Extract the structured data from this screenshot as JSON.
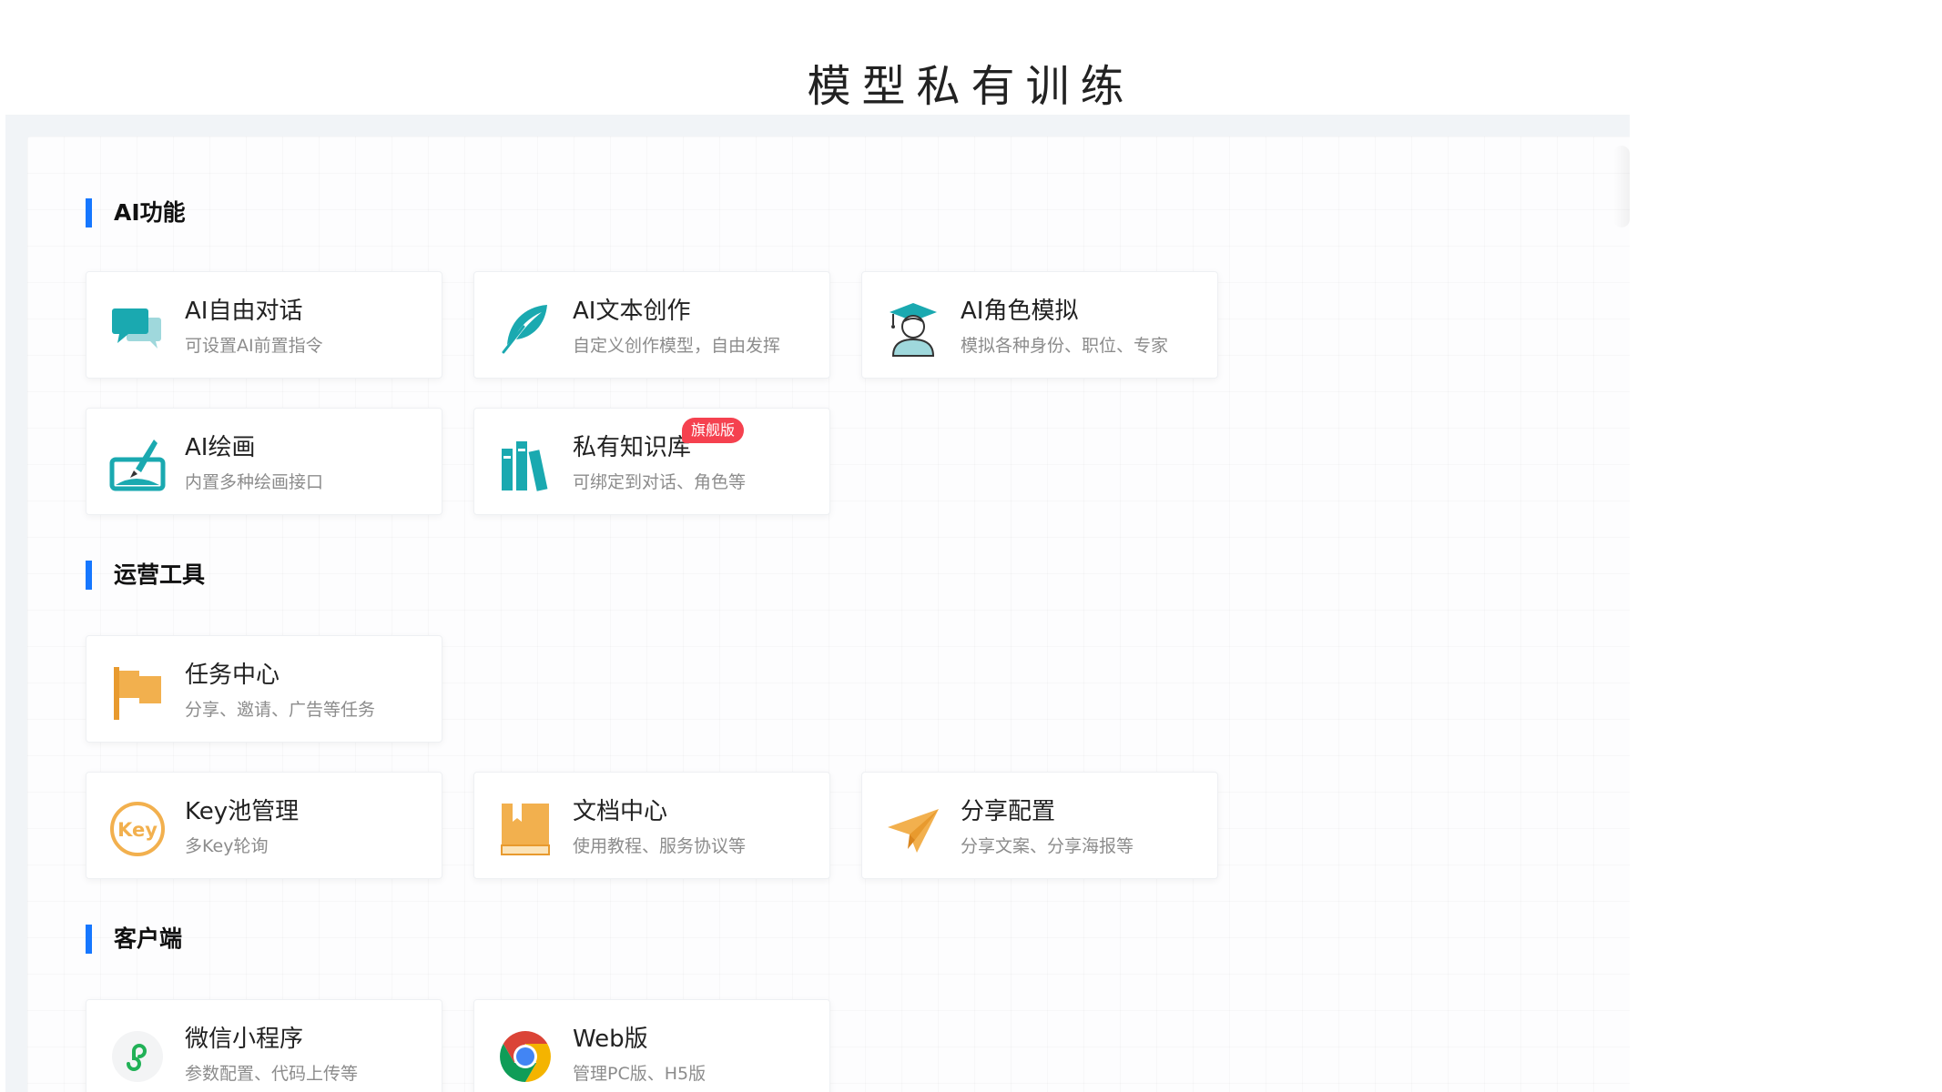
{
  "page_title": "模型私有训练",
  "sections": [
    {
      "title": "AI功能",
      "cards": [
        {
          "name": "AI自由对话",
          "desc": "可设置AI前置指令",
          "icon": "chat-bubbles-icon"
        },
        {
          "name": "AI文本创作",
          "desc": "自定义创作模型，自由发挥",
          "icon": "feather-icon"
        },
        {
          "name": "AI角色模拟",
          "desc": "模拟各种身份、职位、专家",
          "icon": "graduate-avatar-icon"
        },
        {
          "name": "AI绘画",
          "desc": "内置多种绘画接口",
          "icon": "painting-brush-icon"
        },
        {
          "name": "私有知识库",
          "desc": "可绑定到对话、角色等",
          "icon": "books-icon",
          "badge": "旗舰版"
        }
      ]
    },
    {
      "title": "运营工具",
      "cards": [
        {
          "name": "任务中心",
          "desc": "分享、邀请、广告等任务",
          "icon": "flag-icon"
        },
        {
          "name": "Key池管理",
          "desc": "多Key轮询",
          "icon": "key-circle-icon",
          "icon_text": "Key"
        },
        {
          "name": "文档中心",
          "desc": "使用教程、服务协议等",
          "icon": "document-book-icon"
        },
        {
          "name": "分享配置",
          "desc": "分享文案、分享海报等",
          "icon": "paper-plane-icon"
        }
      ]
    },
    {
      "title": "客户端",
      "cards": [
        {
          "name": "微信小程序",
          "desc": "参数配置、代码上传等",
          "icon": "mini-program-icon"
        },
        {
          "name": "Web版",
          "desc": "管理PC版、H5版",
          "icon": "chrome-browser-icon"
        }
      ]
    }
  ],
  "colors": {
    "accent": "#1677ff",
    "teal": "#1aa9b0",
    "orange": "#f2b04e",
    "badge": "#f5414f"
  }
}
